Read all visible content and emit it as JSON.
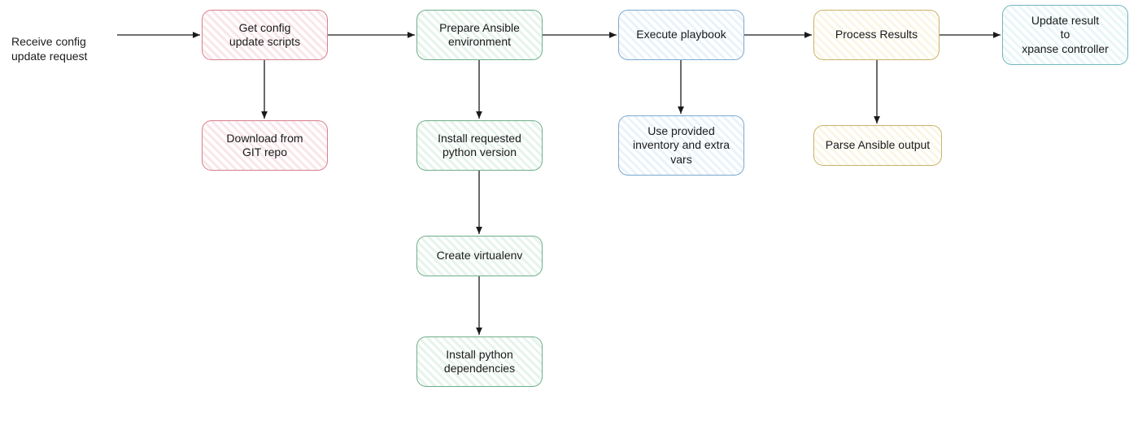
{
  "diagram": {
    "type": "flowchart",
    "start_label": "Receive config\nupdate request",
    "nodes": {
      "get_config": {
        "label": "Get config\nupdate scripts",
        "color": "pink"
      },
      "download_git": {
        "label": "Download from\nGIT repo",
        "color": "pink"
      },
      "prepare_env": {
        "label": "Prepare Ansible\nenvironment",
        "color": "green"
      },
      "install_python": {
        "label": "Install requested\npython version",
        "color": "green"
      },
      "create_venv": {
        "label": "Create virtualenv",
        "color": "green"
      },
      "install_deps": {
        "label": "Install python\ndependencies",
        "color": "green"
      },
      "execute_playbook": {
        "label": "Execute playbook",
        "color": "blue"
      },
      "use_inventory": {
        "label": "Use provided\ninventory and extra\nvars",
        "color": "blue"
      },
      "process_results": {
        "label": "Process Results",
        "color": "yellow"
      },
      "parse_output": {
        "label": "Parse Ansible output",
        "color": "yellow"
      },
      "update_result": {
        "label": "Update result\nto\nxpanse controller",
        "color": "cyan"
      }
    },
    "edges": [
      [
        "start",
        "get_config"
      ],
      [
        "get_config",
        "prepare_env"
      ],
      [
        "get_config",
        "download_git"
      ],
      [
        "prepare_env",
        "execute_playbook"
      ],
      [
        "prepare_env",
        "install_python"
      ],
      [
        "install_python",
        "create_venv"
      ],
      [
        "create_venv",
        "install_deps"
      ],
      [
        "execute_playbook",
        "process_results"
      ],
      [
        "execute_playbook",
        "use_inventory"
      ],
      [
        "process_results",
        "update_result"
      ],
      [
        "process_results",
        "parse_output"
      ]
    ]
  }
}
